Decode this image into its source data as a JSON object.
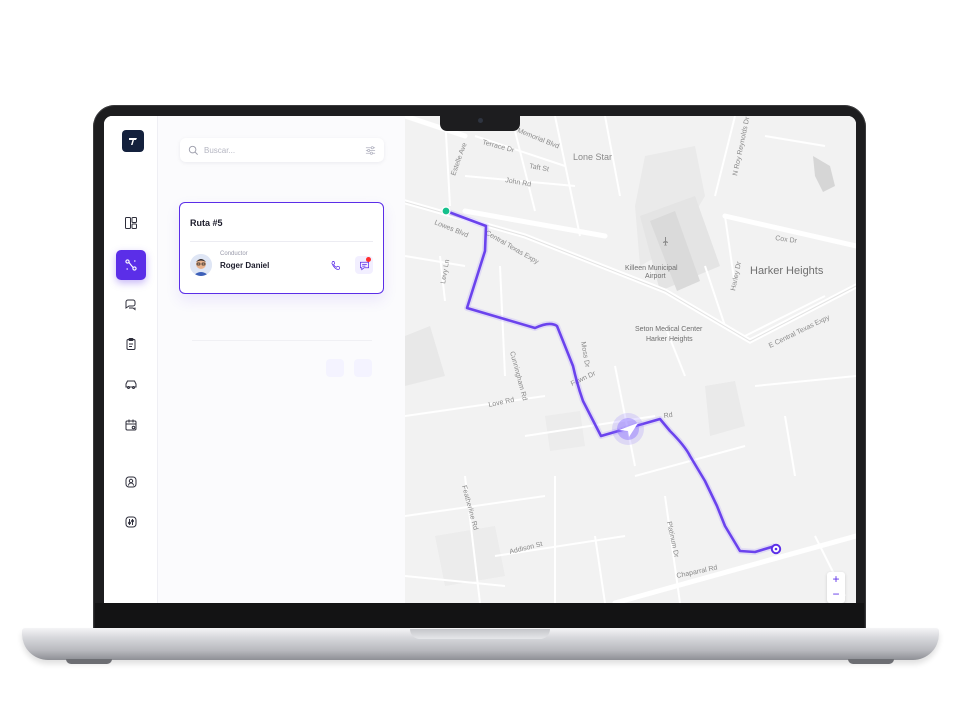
{
  "app": {
    "logo_icon": "brand-t-logo",
    "accent": "#5b2ee8",
    "nav": [
      {
        "icon": "dashboard-icon",
        "active": false
      },
      {
        "icon": "routes-icon",
        "active": true
      },
      {
        "icon": "messages-icon",
        "active": false
      },
      {
        "icon": "clipboard-icon",
        "active": false
      },
      {
        "icon": "vehicles-icon",
        "active": false
      },
      {
        "icon": "calendar-icon",
        "active": false
      },
      {
        "icon": "user-icon",
        "active": false
      },
      {
        "icon": "settings-icon",
        "active": false
      }
    ]
  },
  "search": {
    "placeholder": "Buscar..."
  },
  "route_card": {
    "title": "Ruta #5",
    "driver_role": "Conductor",
    "driver_name": "Roger Daniel",
    "has_unread": true
  },
  "map": {
    "labels": {
      "memorial": "Memorial Blvd",
      "terrace": "Terrace Dr",
      "lone_star": "Lone Star",
      "taft": "Taft St",
      "estelle": "Estelle Ave",
      "john": "John Rd",
      "roy": "N Roy Reynolds Dr",
      "lowes": "Lowes Blvd",
      "central1": "Central Texas Expy",
      "cox": "Cox Dr",
      "levy": "Levy Ln",
      "airport1": "Killeen Municipal",
      "airport2": "Airport",
      "harley": "Harley Dr",
      "harker": "Harker Heights",
      "seton1": "Seton Medical Center",
      "seton2": "Harker Heights",
      "central2": "E Central Texas Expy",
      "cunningham": "Cunningham Rd",
      "moss": "Moss Dr",
      "love": "Love Rd",
      "fawn": "Fawn Dr",
      "rd": "Rd",
      "featherline": "Featherline Rd",
      "addison": "Addison St",
      "platinum": "Platinum Dr",
      "chaparral": "Chaparral Rd"
    },
    "zoom_in": "+",
    "zoom_out": "−",
    "route_color": "#5b2ee8",
    "start_color": "#16c08c"
  }
}
